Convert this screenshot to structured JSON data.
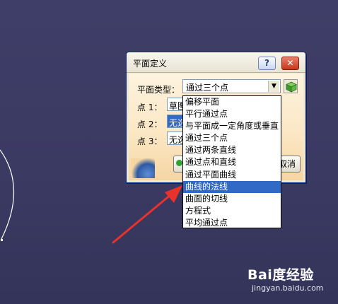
{
  "dialog": {
    "title": "平面定义",
    "help_label": "?",
    "close_label": "✕",
    "plane_type_label": "平面类型：",
    "plane_type_value": "通过三个点",
    "point1_label": "点 1：",
    "point1_value": "草图",
    "point2_label": "点 2：",
    "point2_value": "无选择",
    "point3_label": "点 3：",
    "point3_value": "无选择",
    "cancel_label": "取消"
  },
  "dropdown": {
    "items": [
      "偏移平面",
      "平行通过点",
      "与平面成一定角度或垂直",
      "通过三个点",
      "通过两条直线",
      "通过点和直线",
      "通过平面曲线",
      "曲线的法线",
      "曲面的切线",
      "方程式",
      "平均通过点"
    ],
    "selected_index": 7
  },
  "watermark": {
    "brand": "Bai度经验",
    "url": "jingyan.baidu.com"
  },
  "colors": {
    "background": "#3d3c66",
    "selection": "#3169c6",
    "arrow": "#e8322a"
  }
}
